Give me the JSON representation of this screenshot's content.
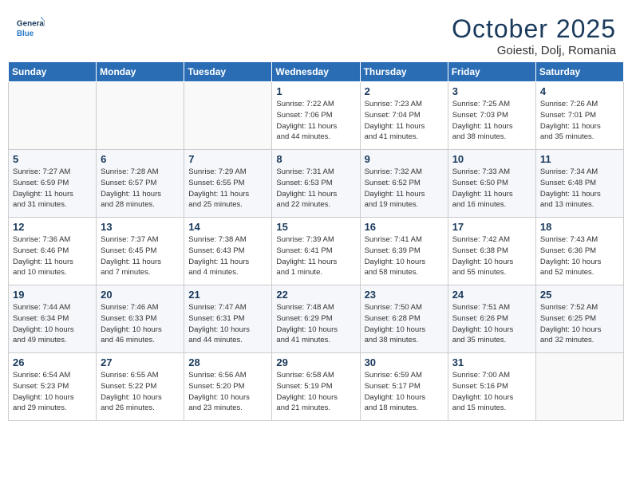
{
  "header": {
    "logo_line1": "General",
    "logo_line2": "Blue",
    "month": "October 2025",
    "location": "Goiesti, Dolj, Romania"
  },
  "weekdays": [
    "Sunday",
    "Monday",
    "Tuesday",
    "Wednesday",
    "Thursday",
    "Friday",
    "Saturday"
  ],
  "weeks": [
    [
      {
        "num": "",
        "info": ""
      },
      {
        "num": "",
        "info": ""
      },
      {
        "num": "",
        "info": ""
      },
      {
        "num": "1",
        "info": "Sunrise: 7:22 AM\nSunset: 7:06 PM\nDaylight: 11 hours\nand 44 minutes."
      },
      {
        "num": "2",
        "info": "Sunrise: 7:23 AM\nSunset: 7:04 PM\nDaylight: 11 hours\nand 41 minutes."
      },
      {
        "num": "3",
        "info": "Sunrise: 7:25 AM\nSunset: 7:03 PM\nDaylight: 11 hours\nand 38 minutes."
      },
      {
        "num": "4",
        "info": "Sunrise: 7:26 AM\nSunset: 7:01 PM\nDaylight: 11 hours\nand 35 minutes."
      }
    ],
    [
      {
        "num": "5",
        "info": "Sunrise: 7:27 AM\nSunset: 6:59 PM\nDaylight: 11 hours\nand 31 minutes."
      },
      {
        "num": "6",
        "info": "Sunrise: 7:28 AM\nSunset: 6:57 PM\nDaylight: 11 hours\nand 28 minutes."
      },
      {
        "num": "7",
        "info": "Sunrise: 7:29 AM\nSunset: 6:55 PM\nDaylight: 11 hours\nand 25 minutes."
      },
      {
        "num": "8",
        "info": "Sunrise: 7:31 AM\nSunset: 6:53 PM\nDaylight: 11 hours\nand 22 minutes."
      },
      {
        "num": "9",
        "info": "Sunrise: 7:32 AM\nSunset: 6:52 PM\nDaylight: 11 hours\nand 19 minutes."
      },
      {
        "num": "10",
        "info": "Sunrise: 7:33 AM\nSunset: 6:50 PM\nDaylight: 11 hours\nand 16 minutes."
      },
      {
        "num": "11",
        "info": "Sunrise: 7:34 AM\nSunset: 6:48 PM\nDaylight: 11 hours\nand 13 minutes."
      }
    ],
    [
      {
        "num": "12",
        "info": "Sunrise: 7:36 AM\nSunset: 6:46 PM\nDaylight: 11 hours\nand 10 minutes."
      },
      {
        "num": "13",
        "info": "Sunrise: 7:37 AM\nSunset: 6:45 PM\nDaylight: 11 hours\nand 7 minutes."
      },
      {
        "num": "14",
        "info": "Sunrise: 7:38 AM\nSunset: 6:43 PM\nDaylight: 11 hours\nand 4 minutes."
      },
      {
        "num": "15",
        "info": "Sunrise: 7:39 AM\nSunset: 6:41 PM\nDaylight: 11 hours\nand 1 minute."
      },
      {
        "num": "16",
        "info": "Sunrise: 7:41 AM\nSunset: 6:39 PM\nDaylight: 10 hours\nand 58 minutes."
      },
      {
        "num": "17",
        "info": "Sunrise: 7:42 AM\nSunset: 6:38 PM\nDaylight: 10 hours\nand 55 minutes."
      },
      {
        "num": "18",
        "info": "Sunrise: 7:43 AM\nSunset: 6:36 PM\nDaylight: 10 hours\nand 52 minutes."
      }
    ],
    [
      {
        "num": "19",
        "info": "Sunrise: 7:44 AM\nSunset: 6:34 PM\nDaylight: 10 hours\nand 49 minutes."
      },
      {
        "num": "20",
        "info": "Sunrise: 7:46 AM\nSunset: 6:33 PM\nDaylight: 10 hours\nand 46 minutes."
      },
      {
        "num": "21",
        "info": "Sunrise: 7:47 AM\nSunset: 6:31 PM\nDaylight: 10 hours\nand 44 minutes."
      },
      {
        "num": "22",
        "info": "Sunrise: 7:48 AM\nSunset: 6:29 PM\nDaylight: 10 hours\nand 41 minutes."
      },
      {
        "num": "23",
        "info": "Sunrise: 7:50 AM\nSunset: 6:28 PM\nDaylight: 10 hours\nand 38 minutes."
      },
      {
        "num": "24",
        "info": "Sunrise: 7:51 AM\nSunset: 6:26 PM\nDaylight: 10 hours\nand 35 minutes."
      },
      {
        "num": "25",
        "info": "Sunrise: 7:52 AM\nSunset: 6:25 PM\nDaylight: 10 hours\nand 32 minutes."
      }
    ],
    [
      {
        "num": "26",
        "info": "Sunrise: 6:54 AM\nSunset: 5:23 PM\nDaylight: 10 hours\nand 29 minutes."
      },
      {
        "num": "27",
        "info": "Sunrise: 6:55 AM\nSunset: 5:22 PM\nDaylight: 10 hours\nand 26 minutes."
      },
      {
        "num": "28",
        "info": "Sunrise: 6:56 AM\nSunset: 5:20 PM\nDaylight: 10 hours\nand 23 minutes."
      },
      {
        "num": "29",
        "info": "Sunrise: 6:58 AM\nSunset: 5:19 PM\nDaylight: 10 hours\nand 21 minutes."
      },
      {
        "num": "30",
        "info": "Sunrise: 6:59 AM\nSunset: 5:17 PM\nDaylight: 10 hours\nand 18 minutes."
      },
      {
        "num": "31",
        "info": "Sunrise: 7:00 AM\nSunset: 5:16 PM\nDaylight: 10 hours\nand 15 minutes."
      },
      {
        "num": "",
        "info": ""
      }
    ]
  ]
}
